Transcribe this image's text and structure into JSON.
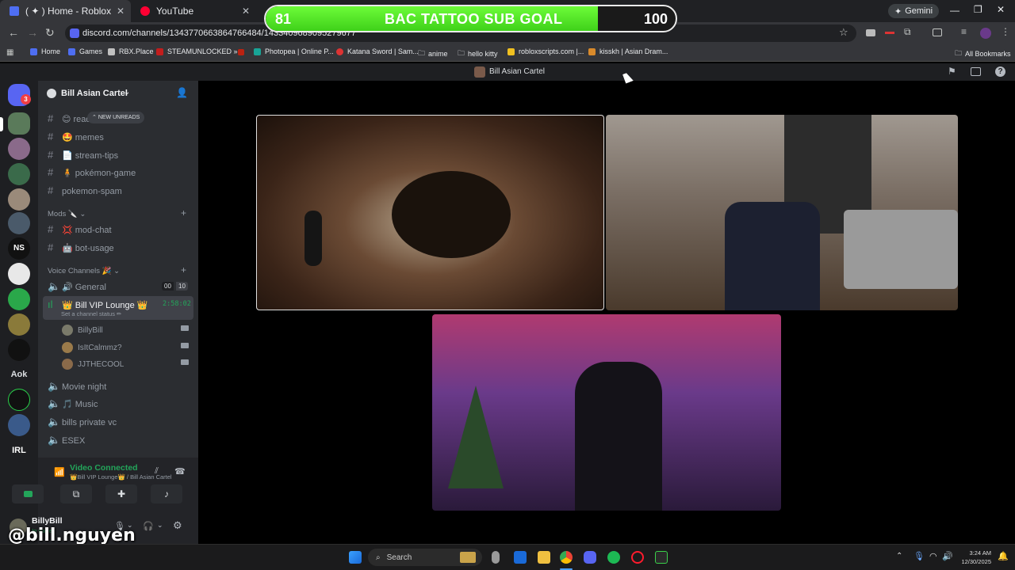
{
  "browser": {
    "tabs": [
      {
        "label": "( ✦ ) Home - Roblox",
        "color": "#4e6ef2"
      },
      {
        "label": "YouTube",
        "color": "#ff0033"
      }
    ],
    "url": "discord.com/channels/1343770663864766484/1433409689095279677",
    "gemini_label": "Gemini",
    "bookmarks": [
      "Home",
      "Games",
      "RBX.Place",
      "STEAMUNLOCKED »...",
      "Photopea | Online P...",
      "Katana Sword | Sam...",
      "anime",
      "hello kitty",
      "robloxscripts.com |...",
      "kisskh | Asian Dram..."
    ],
    "all_bookmarks_label": "All Bookmarks"
  },
  "sub_goal": {
    "start": "81",
    "title": "BAC TATTOO SUB GOAL",
    "end": "100",
    "progress_fraction": 0.81
  },
  "discord": {
    "window_title": "Bill Asian Cartel",
    "server_name": "Bill Asian Cartel",
    "new_unreads": "NEW UNREADS",
    "notification_count": "3",
    "channels": [
      {
        "icon": "#",
        "label": "😊 read"
      },
      {
        "icon": "#",
        "label": "🤩 memes"
      },
      {
        "icon": "#",
        "label": "📄 stream-tips"
      },
      {
        "icon": "#",
        "label": "🧍 pokémon-game"
      },
      {
        "icon": "#",
        "label": "pokemon-spam"
      }
    ],
    "mods_category": "Mods 🔪",
    "mod_channels": [
      {
        "icon": "#",
        "label": "💢 mod-chat"
      },
      {
        "icon": "#",
        "label": "🤖 bot-usage"
      }
    ],
    "voice_category": "Voice Channels 🎉",
    "voice_channels": {
      "general": "🔊 General",
      "general_count_a": "00",
      "general_count_b": "10",
      "vip": "👑 Bill VIP Lounge 👑",
      "vip_timer": "2:58:02",
      "vip_status": "Set a channel status ✏",
      "members": [
        "BillyBill",
        "IsItCalmmz?",
        "JJTHECOOL"
      ],
      "movie": "Movie night",
      "music": "🎵 Music",
      "private": "bills private vc",
      "esex": "ESEX"
    },
    "voice_panel": {
      "status": "Video Connected",
      "location": "👑Bill VIP Lounge👑 / Bill Asian Cartel"
    },
    "user_panel": {
      "name": "BillyBill",
      "status": "In voice"
    },
    "server_letters": [
      "NS",
      "Aok",
      "IRL"
    ]
  },
  "watermark": "@bill.nguyen",
  "taskbar": {
    "search": "Search",
    "time": "3:24 AM",
    "date": "12/30/2025"
  },
  "colors": {
    "accent_green": "#23a55a",
    "discord_bg": "#2b2d31",
    "goal_green": "#4fe024"
  }
}
